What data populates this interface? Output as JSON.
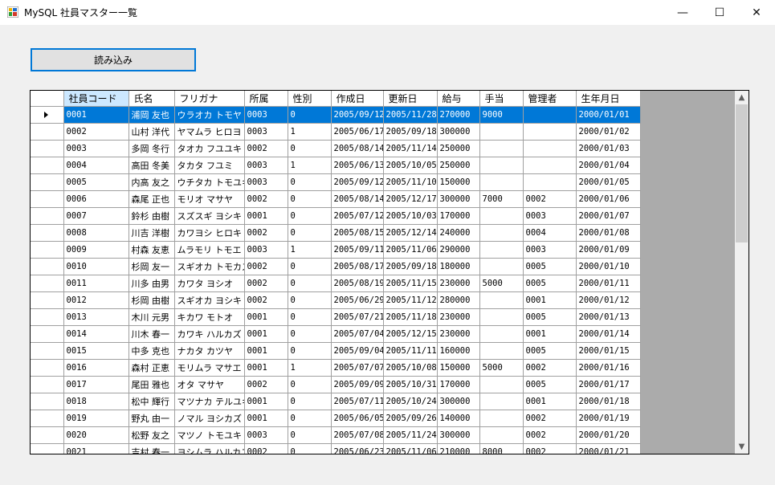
{
  "window": {
    "title": "MySQL 社員マスター一覧",
    "minimize": "—",
    "maximize": "☐",
    "close": "✕"
  },
  "toolbar": {
    "load_label": "読み込み"
  },
  "grid": {
    "columns": [
      "社員コード",
      "氏名",
      "フリガナ",
      "所属",
      "性別",
      "作成日",
      "更新日",
      "給与",
      "手当",
      "管理者",
      "生年月日"
    ],
    "selected_row": 0,
    "rows": [
      [
        "0001",
        "浦岡 友也",
        "ウラオカ トモヤ",
        "0003",
        "0",
        "2005/09/12",
        "2005/11/28",
        "270000",
        "9000",
        "",
        "2000/01/01"
      ],
      [
        "0002",
        "山村 洋代",
        "ヤマムラ ヒロヨ",
        "0003",
        "1",
        "2005/06/17",
        "2005/09/18",
        "300000",
        "",
        "",
        "2000/01/02"
      ],
      [
        "0003",
        "多岡 冬行",
        "タオカ フユユキ",
        "0002",
        "0",
        "2005/08/14",
        "2005/11/14",
        "250000",
        "",
        "",
        "2000/01/03"
      ],
      [
        "0004",
        "高田 冬美",
        "タカタ フユミ",
        "0003",
        "1",
        "2005/06/13",
        "2005/10/05",
        "250000",
        "",
        "",
        "2000/01/04"
      ],
      [
        "0005",
        "内高 友之",
        "ウチタカ トモユキ",
        "0003",
        "0",
        "2005/09/12",
        "2005/11/10",
        "150000",
        "",
        "",
        "2000/01/05"
      ],
      [
        "0006",
        "森尾 正也",
        "モリオ マサヤ",
        "0002",
        "0",
        "2005/08/14",
        "2005/12/17",
        "300000",
        "7000",
        "0002",
        "2000/01/06"
      ],
      [
        "0007",
        "鈴杉 由樹",
        "スズスギ ヨシキ",
        "0001",
        "0",
        "2005/07/12",
        "2005/10/03",
        "170000",
        "",
        "0003",
        "2000/01/07"
      ],
      [
        "0008",
        "川吉 洋樹",
        "カワヨシ ヒロキ",
        "0002",
        "0",
        "2005/08/15",
        "2005/12/14",
        "240000",
        "",
        "0004",
        "2000/01/08"
      ],
      [
        "0009",
        "村森 友恵",
        "ムラモリ トモエ",
        "0003",
        "1",
        "2005/09/11",
        "2005/11/06",
        "290000",
        "",
        "0003",
        "2000/01/09"
      ],
      [
        "0010",
        "杉岡 友一",
        "スギオカ トモカズ",
        "0002",
        "0",
        "2005/08/17",
        "2005/09/18",
        "180000",
        "",
        "0005",
        "2000/01/10"
      ],
      [
        "0011",
        "川多 由男",
        "カワタ ヨシオ",
        "0002",
        "0",
        "2005/08/19",
        "2005/11/15",
        "230000",
        "5000",
        "0005",
        "2000/01/11"
      ],
      [
        "0012",
        "杉岡 由樹",
        "スギオカ ヨシキ",
        "0002",
        "0",
        "2005/06/29",
        "2005/11/12",
        "280000",
        "",
        "0001",
        "2000/01/12"
      ],
      [
        "0013",
        "木川 元男",
        "キカワ モトオ",
        "0001",
        "0",
        "2005/07/21",
        "2005/11/18",
        "230000",
        "",
        "0005",
        "2000/01/13"
      ],
      [
        "0014",
        "川木 春一",
        "カワキ ハルカズ",
        "0001",
        "0",
        "2005/07/04",
        "2005/12/15",
        "230000",
        "",
        "0001",
        "2000/01/14"
      ],
      [
        "0015",
        "中多 克也",
        "ナカタ カツヤ",
        "0001",
        "0",
        "2005/09/04",
        "2005/11/11",
        "160000",
        "",
        "0005",
        "2000/01/15"
      ],
      [
        "0016",
        "森村 正恵",
        "モリムラ マサエ",
        "0001",
        "1",
        "2005/07/07",
        "2005/10/08",
        "150000",
        "5000",
        "0002",
        "2000/01/16"
      ],
      [
        "0017",
        "尾田 雅也",
        "オタ マサヤ",
        "0002",
        "0",
        "2005/09/09",
        "2005/10/31",
        "170000",
        "",
        "0005",
        "2000/01/17"
      ],
      [
        "0018",
        "松中 輝行",
        "マツナカ テルユキ",
        "0001",
        "0",
        "2005/07/11",
        "2005/10/24",
        "300000",
        "",
        "0001",
        "2000/01/18"
      ],
      [
        "0019",
        "野丸 由一",
        "ノマル ヨシカズ",
        "0001",
        "0",
        "2005/06/05",
        "2005/09/26",
        "140000",
        "",
        "0002",
        "2000/01/19"
      ],
      [
        "0020",
        "松野 友之",
        "マツノ トモユキ",
        "0003",
        "0",
        "2005/07/08",
        "2005/11/24",
        "300000",
        "",
        "0002",
        "2000/01/20"
      ],
      [
        "0021",
        "吉村 春一",
        "ヨシムラ ハルカズ",
        "0002",
        "0",
        "2005/06/23",
        "2005/11/06",
        "210000",
        "8000",
        "0002",
        "2000/01/21"
      ]
    ]
  },
  "scrollbar": {
    "up": "▲",
    "down": "▼"
  },
  "colors": {
    "selection": "#0078d7",
    "header_selected": "#cce8ff",
    "grid_background": "#ababab"
  }
}
